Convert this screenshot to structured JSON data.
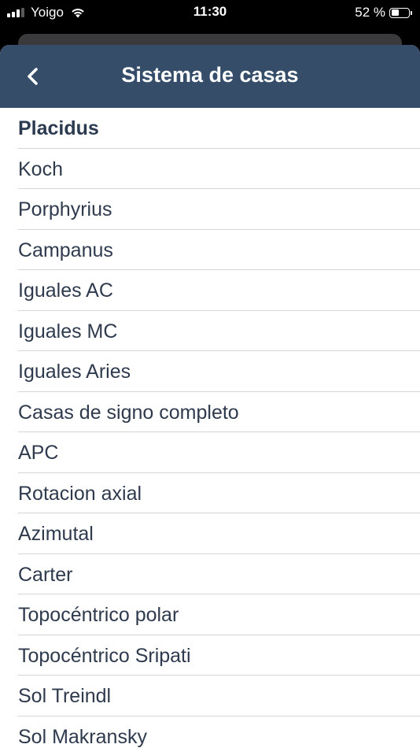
{
  "status_bar": {
    "carrier": "Yoigo",
    "time": "11:30",
    "battery_percent": "52 %",
    "battery_level": 0.52,
    "signal_bars": 3,
    "wifi_icon": "wifi-icon"
  },
  "nav": {
    "title": "Sistema de casas",
    "back_icon": "chevron-left-icon"
  },
  "colors": {
    "nav_background": "#364d69",
    "text": "#2f3a4c",
    "divider": "#d6d6d6"
  },
  "houses": {
    "selected": "Placidus",
    "items": [
      {
        "label": "Placidus"
      },
      {
        "label": "Koch"
      },
      {
        "label": "Porphyrius"
      },
      {
        "label": "Campanus"
      },
      {
        "label": "Iguales AC"
      },
      {
        "label": "Iguales MC"
      },
      {
        "label": "Iguales Aries"
      },
      {
        "label": "Casas de signo completo"
      },
      {
        "label": "APC"
      },
      {
        "label": "Rotacion axial"
      },
      {
        "label": "Azimutal"
      },
      {
        "label": "Carter"
      },
      {
        "label": "Topocéntrico polar"
      },
      {
        "label": "Topocéntrico Sripati"
      },
      {
        "label": "Sol Treindl"
      },
      {
        "label": "Sol Makransky"
      }
    ]
  }
}
